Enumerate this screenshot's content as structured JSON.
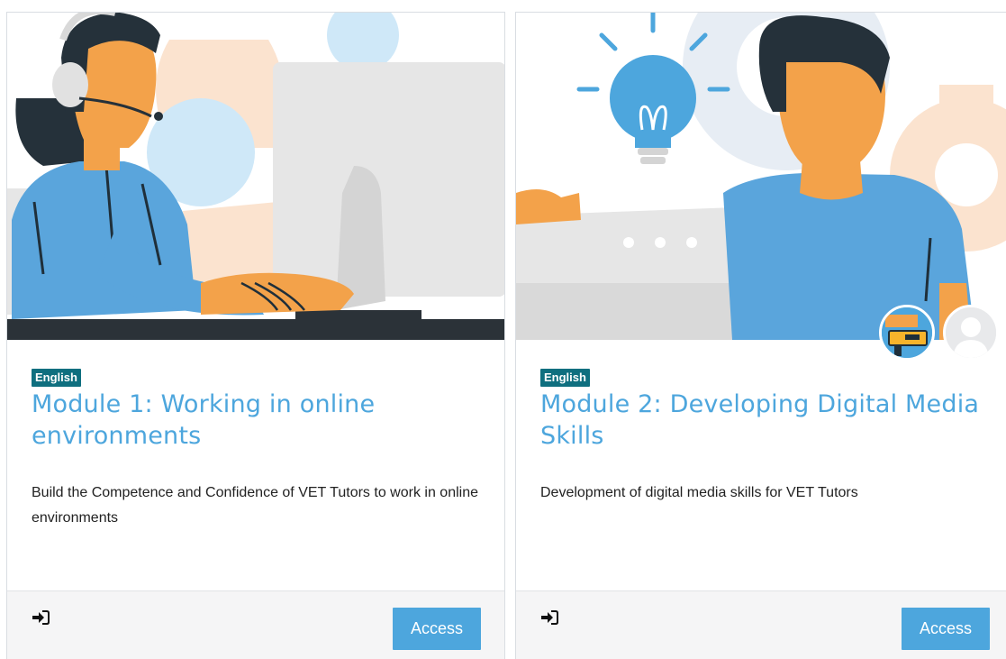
{
  "courses": [
    {
      "language": "English",
      "title": "Module 1: Working in online environments",
      "description": "Build the Competence and Confidence of VET Tutors to work in online environments",
      "access_label": "Access",
      "hero_icon": "person-with-headset-at-computer-illustration",
      "enter_icon": "sign-in-icon"
    },
    {
      "language": "English",
      "title": "Module 2: Developing Digital Media Skills",
      "description": "Development of digital media skills for VET Tutors",
      "access_label": "Access",
      "hero_icon": "person-with-lightbulb-and-gears-illustration",
      "enter_icon": "sign-in-icon",
      "avatars": [
        "teacher-avatar",
        "default-user-avatar"
      ]
    }
  ],
  "colors": {
    "accent": "#4da6dd",
    "badge": "#0f6f7f",
    "footer_bg": "#f5f5f6",
    "skin": "#f3a24a",
    "shirt": "#5aa5dc",
    "hair": "#25313a"
  }
}
